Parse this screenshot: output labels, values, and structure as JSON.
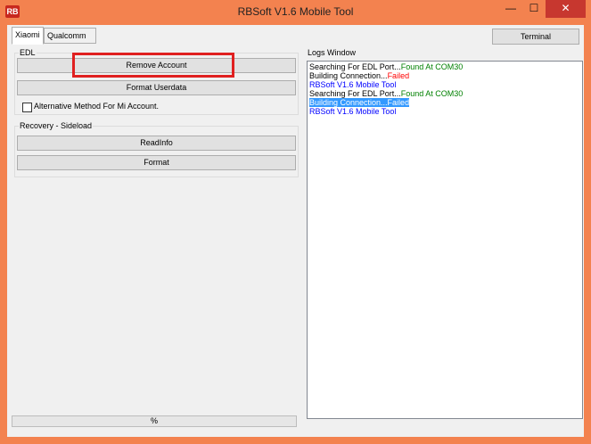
{
  "window": {
    "title": "RBSoft V1.6 Mobile Tool",
    "icon_text": "RB",
    "minimize_glyph": "—",
    "maximize_glyph": "☐",
    "close_glyph": "✕"
  },
  "tabs": [
    {
      "label": "Xiaomi",
      "active": true
    },
    {
      "label": "Qualcomm",
      "active": false
    }
  ],
  "terminal_label": "Terminal",
  "edl": {
    "title": "EDL",
    "remove_account": "Remove Account",
    "format_userdata": "Format Userdata",
    "alt_method": "Alternative Method For Mi Account.",
    "alt_method_checked": false
  },
  "recovery": {
    "title": "Recovery - Sideload",
    "readinfo": "ReadInfo",
    "format": "Format"
  },
  "logs": {
    "title": "Logs Window",
    "lines": [
      {
        "text": "Searching For EDL Port...",
        "status": "Found At COM30",
        "status_color": "green"
      },
      {
        "text": "Building Connection...",
        "status": "Failed",
        "status_color": "red"
      },
      {
        "text": "RBSoft V1.6 Mobile Tool",
        "color": "blue"
      },
      {
        "text": "Searching For EDL Port...",
        "status": "Found At COM30",
        "status_color": "green"
      },
      {
        "text": "Building Connection...Failed",
        "selected": true
      },
      {
        "text": "RBSoft V1.6 Mobile Tool",
        "color": "blue"
      }
    ]
  },
  "status_bar": {
    "progress": "%"
  },
  "colors": {
    "frame": "#f3824f",
    "close": "#c7372f",
    "highlight": "#e02020"
  }
}
